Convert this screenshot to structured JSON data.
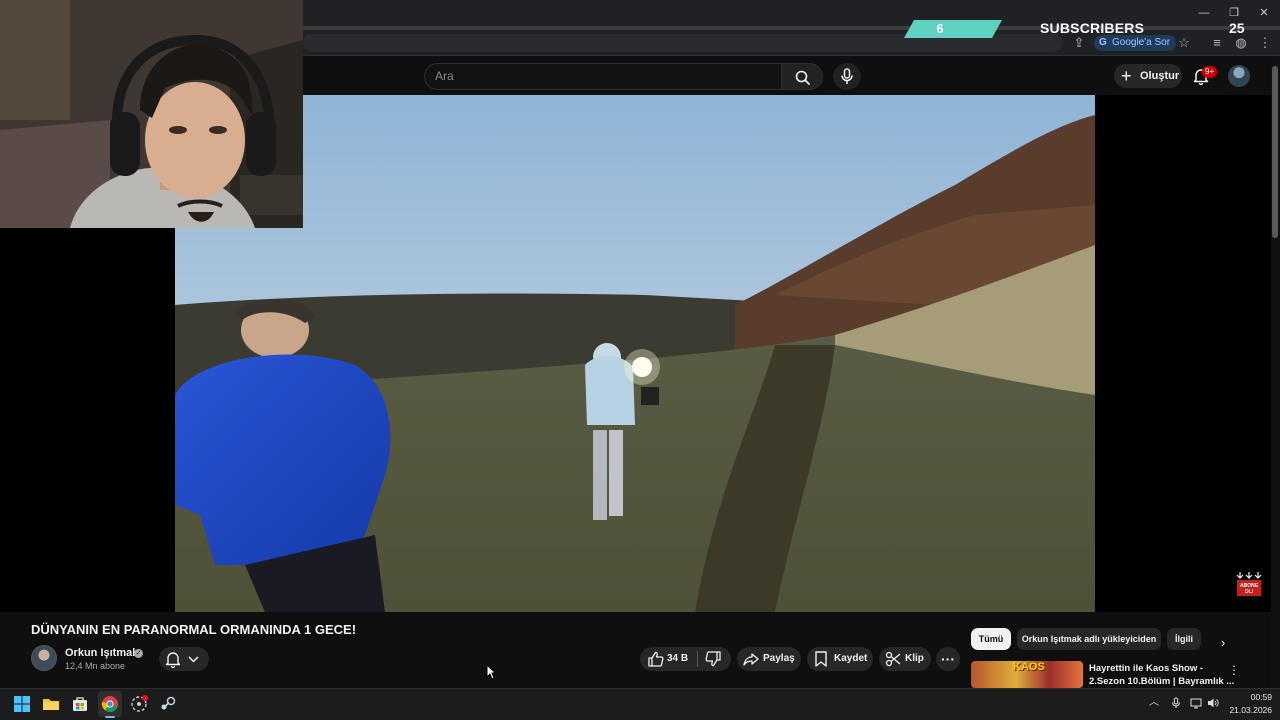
{
  "overlay": {
    "subscriber_count": "6",
    "subscribers_label": "SUBSCRIBERS",
    "subscriber_goal": "25",
    "progress_fraction": 0.24,
    "accent_color": "#5ed1c1"
  },
  "browser": {
    "ask_google_label": "Google'a Sor",
    "window_controls": [
      "minimize-icon",
      "restore-icon",
      "close-icon"
    ],
    "toolbar_icons": [
      "share-icon",
      "google-lens-icon",
      "star-icon",
      "media-icon",
      "extensions-icon",
      "menu-icon"
    ]
  },
  "youtube_header": {
    "search_placeholder": "Ara",
    "create_label": "Oluştur",
    "notification_badge": "9+"
  },
  "video": {
    "title": "DÜNYANIN EN PARANORMAL ORMANINDA 1 GECE!",
    "subscribe_overlay_text": "ABONE OL!"
  },
  "channel": {
    "name": "Orkun Işıtmak",
    "subscribers": "12,4 Mn abone"
  },
  "actions": {
    "like_count": "34 B",
    "share_label": "Paylaş",
    "save_label": "Kaydet",
    "clip_label": "Klip",
    "more_label": "···"
  },
  "chips": [
    "Tümü",
    "Orkun Işıtmak adlı yükleyiciden",
    "İlgili"
  ],
  "recommendation": {
    "thumbnail_text": "KAOS",
    "title_line1": "Hayrettin ile Kaos Show -",
    "title_line2": "2.Sezon 10.Bölüm | Bayramlık ..."
  },
  "taskbar": {
    "time": "00:59",
    "date": "21.03.2026",
    "pinned": [
      "windows-start-icon",
      "file-explorer-icon",
      "microsoft-store-icon",
      "chrome-icon",
      "game-app-icon",
      "steam-icon"
    ],
    "tray": [
      "chevron-up-icon",
      "microphone-icon",
      "network-icon",
      "volume-icon"
    ]
  }
}
